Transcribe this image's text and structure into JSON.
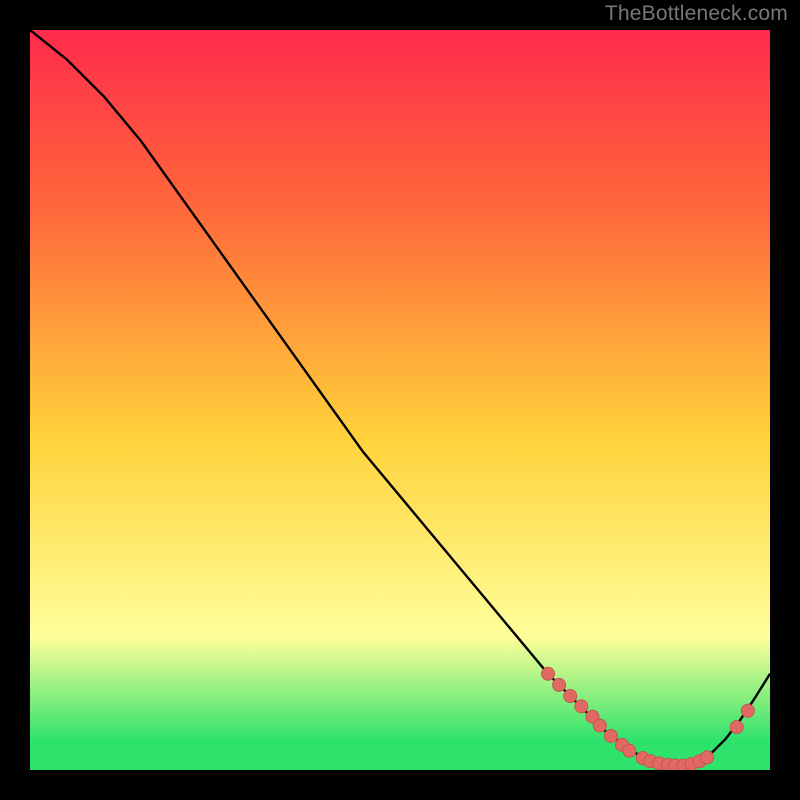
{
  "watermark": "TheBottleneck.com",
  "colors": {
    "page_bg": "#000000",
    "gradient_top": "#ff2b4b",
    "gradient_mid_upper": "#ff6a3a",
    "gradient_mid": "#ffd23a",
    "gradient_low": "#ffff9a",
    "gradient_bottom": "#2fe26b",
    "curve": "#000000",
    "marker_fill": "#e06a63",
    "marker_stroke": "#c9544f"
  },
  "chart_data": {
    "type": "line",
    "title": "",
    "xlabel": "",
    "ylabel": "",
    "xlim": [
      0,
      100
    ],
    "ylim": [
      0,
      100
    ],
    "legend": false,
    "grid": false,
    "series": [
      {
        "name": "curve",
        "x": [
          0,
          5,
          10,
          15,
          20,
          25,
          30,
          35,
          40,
          45,
          50,
          55,
          60,
          65,
          70,
          72,
          74,
          76,
          78,
          80,
          82,
          84,
          86,
          88,
          90,
          92,
          94,
          96,
          98,
          100
        ],
        "y": [
          100,
          96,
          91,
          85,
          78,
          71,
          64,
          57,
          50,
          43,
          37,
          31,
          25,
          19,
          13,
          11,
          9,
          7,
          5,
          3.5,
          2.2,
          1.3,
          0.8,
          0.6,
          1.0,
          2.2,
          4.2,
          6.8,
          9.8,
          13
        ]
      }
    ],
    "markers": [
      {
        "x": 70.0,
        "y": 13.0
      },
      {
        "x": 71.5,
        "y": 11.5
      },
      {
        "x": 73.0,
        "y": 10.0
      },
      {
        "x": 74.5,
        "y": 8.6
      },
      {
        "x": 76.0,
        "y": 7.2
      },
      {
        "x": 77.0,
        "y": 6.0
      },
      {
        "x": 78.5,
        "y": 4.6
      },
      {
        "x": 80.0,
        "y": 3.4
      },
      {
        "x": 81.0,
        "y": 2.6
      },
      {
        "x": 82.8,
        "y": 1.6
      },
      {
        "x": 83.8,
        "y": 1.2
      },
      {
        "x": 85.0,
        "y": 0.9
      },
      {
        "x": 86.2,
        "y": 0.7
      },
      {
        "x": 87.2,
        "y": 0.6
      },
      {
        "x": 88.3,
        "y": 0.6
      },
      {
        "x": 89.4,
        "y": 0.8
      },
      {
        "x": 90.5,
        "y": 1.2
      },
      {
        "x": 91.5,
        "y": 1.7
      },
      {
        "x": 95.5,
        "y": 5.8
      },
      {
        "x": 97.0,
        "y": 8.0
      }
    ],
    "gradient_stops": [
      {
        "offset": 0.0,
        "color_key": "gradient_top"
      },
      {
        "offset": 0.25,
        "color_key": "gradient_mid_upper"
      },
      {
        "offset": 0.55,
        "color_key": "gradient_mid"
      },
      {
        "offset": 0.82,
        "color_key": "gradient_low"
      },
      {
        "offset": 0.96,
        "color_key": "gradient_bottom"
      },
      {
        "offset": 1.0,
        "color_key": "gradient_bottom"
      }
    ]
  }
}
